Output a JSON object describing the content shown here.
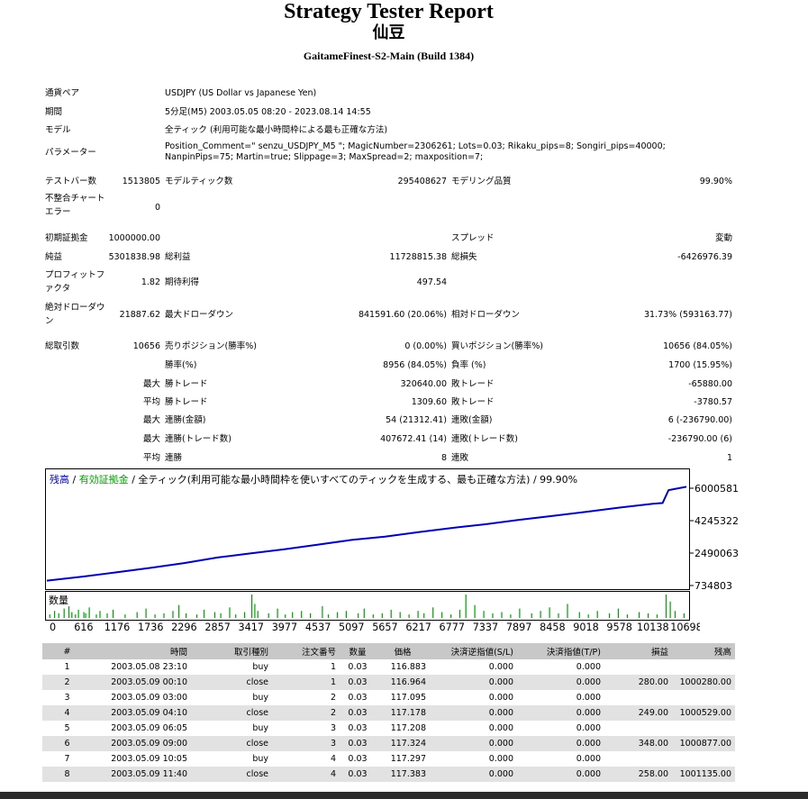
{
  "header": {
    "title": "Strategy Tester Report",
    "ea_name": "仙豆",
    "server": "GaitameFinest-S2-Main (Build 1384)"
  },
  "settings": [
    {
      "label": "通貨ペア",
      "value": "USDJPY (US Dollar vs Japanese Yen)"
    },
    {
      "label": "期間",
      "value": "5分足(M5) 2003.05.05 08:20 - 2023.08.14 14:55"
    },
    {
      "label": "モデル",
      "value": "全ティック (利用可能な最小時間枠による最も正確な方法)"
    },
    {
      "label": "パラメーター",
      "value": "Position_Comment=\" senzu_USDJPY_M5 \"; MagicNumber=2306261; Lots=0.03; Rikaku_pips=8; Songiri_pips=40000; NanpinPips=75; Martin=true; Slippage=3; MaxSpread=2; maxposition=7;"
    }
  ],
  "stats": {
    "bars_label": "テストバー数",
    "bars_value": "1513805",
    "ticks_label": "モデルティック数",
    "ticks_value": "295408627",
    "quality_label": "モデリング品質",
    "quality_value": "99.90%",
    "mismatch_label": "不整合チャートエラー",
    "mismatch_value": "0",
    "deposit_label": "初期証拠金",
    "deposit_value": "1000000.00",
    "spread_label": "スプレッド",
    "spread_value": "変動",
    "net_label": "純益",
    "net_value": "5301838.98",
    "gross_profit_label": "総利益",
    "gross_profit_value": "11728815.38",
    "gross_loss_label": "総損失",
    "gross_loss_value": "-6426976.39",
    "pf_label": "プロフィットファクタ",
    "pf_value": "1.82",
    "expected_label": "期待利得",
    "expected_value": "497.54",
    "abs_dd_label": "絶対ドローダウン",
    "abs_dd_value": "21887.62",
    "max_dd_label": "最大ドローダウン",
    "max_dd_value": "841591.60 (20.06%)",
    "rel_dd_label": "相対ドローダウン",
    "rel_dd_value": "31.73% (593163.77)",
    "total_label": "総取引数",
    "total_value": "10656",
    "short_label": "売りポジション(勝率%)",
    "short_value": "0 (0.00%)",
    "long_label": "買いポジション(勝率%)",
    "long_value": "10656 (84.05%)",
    "win_label": "勝率(%)",
    "win_value": "8956 (84.05%)",
    "loss_label": "負率 (%)",
    "loss_value": "1700 (15.95%)",
    "max_word": "最大",
    "avg_word": "平均",
    "largest_win_label": "勝トレード",
    "largest_win_value": "320640.00",
    "largest_loss_label": "敗トレード",
    "largest_loss_value": "-65880.00",
    "avg_win_label": "勝トレード",
    "avg_win_value": "1309.60",
    "avg_loss_label": "敗トレード",
    "avg_loss_value": "-3780.57",
    "cons_wins_amt_label": "連勝(金額)",
    "cons_wins_amt_value": "54 (21312.41)",
    "cons_loss_amt_label": "連敗(金額)",
    "cons_loss_amt_value": "6 (-236790.00)",
    "cons_wins_cnt_label": "連勝(トレード数)",
    "cons_wins_cnt_value": "407672.41 (14)",
    "cons_loss_cnt_label": "連敗(トレード数)",
    "cons_loss_cnt_value": "-236790.00 (6)",
    "avg_cons_wins_label": "連勝",
    "avg_cons_wins_value": "8",
    "avg_cons_loss_label": "連敗",
    "avg_cons_loss_value": "1"
  },
  "chart_legend": {
    "balance": "残高",
    "sep1": " / ",
    "equity": "有効証拠金",
    "sep2": " / ",
    "rest": "全ティック(利用可能な最小時間枠を使いすべてのティックを生成する、最も正確な方法) / 99.90%"
  },
  "volume_label": "数量",
  "chart_data": {
    "type": "line",
    "title": "",
    "y_ticks": [
      "6000581",
      "4245322",
      "2490063",
      "734803"
    ],
    "x_ticks": [
      "0",
      "616",
      "1176",
      "1736",
      "2296",
      "2857",
      "3417",
      "3977",
      "4537",
      "5097",
      "5657",
      "6217",
      "6777",
      "7337",
      "7897",
      "8458",
      "9018",
      "9578",
      "10138",
      "10698"
    ],
    "ylim": [
      734803,
      6000581
    ],
    "xlim": [
      0,
      10698
    ],
    "series": [
      {
        "name": "残高",
        "color": "#0000b4",
        "x": [
          0,
          616,
          1176,
          1736,
          2296,
          2857,
          3417,
          3977,
          4537,
          5097,
          5657,
          6217,
          6777,
          7337,
          7897,
          8458,
          9018,
          9578,
          10138,
          10300,
          10400,
          10698
        ],
        "y": [
          1000000,
          1220000,
          1450000,
          1690000,
          1950000,
          2250000,
          2480000,
          2700000,
          2950000,
          3200000,
          3380000,
          3620000,
          3850000,
          4050000,
          4290000,
          4500000,
          4720000,
          4950000,
          5160000,
          5200000,
          5900000,
          6080000
        ]
      },
      {
        "name": "有効証拠金",
        "color": "#00a000"
      }
    ],
    "volume_x": [
      40,
      120,
      190,
      280,
      360,
      410,
      470,
      520,
      610,
      640,
      700,
      820,
      880,
      1000,
      1100,
      1300,
      1500,
      1650,
      1800,
      1950,
      2100,
      2200,
      2320,
      2500,
      2620,
      2800,
      2900,
      3050,
      3150,
      3300,
      3420,
      3470,
      3520,
      3700,
      3850,
      3980,
      4100,
      4250,
      4400,
      4600,
      4700,
      4850,
      5000,
      5200,
      5300,
      5450,
      5600,
      5750,
      5900,
      6050,
      6200,
      6300,
      6450,
      6600,
      6750,
      6900,
      7000,
      7150,
      7300,
      7450,
      7600,
      7750,
      7900,
      8100,
      8250,
      8400,
      8550,
      8700,
      8900,
      9050,
      9200,
      9400,
      9550,
      9700,
      9900,
      10050,
      10200,
      10350,
      10420,
      10500,
      10650
    ],
    "volume_v": [
      3,
      6,
      4,
      8,
      10,
      5,
      3,
      7,
      5,
      4,
      9,
      3,
      6,
      4,
      7,
      3,
      5,
      8,
      3,
      4,
      6,
      11,
      4,
      3,
      7,
      5,
      4,
      9,
      3,
      5,
      20,
      12,
      6,
      4,
      8,
      3,
      5,
      6,
      4,
      10,
      3,
      5,
      6,
      4,
      8,
      3,
      4,
      7,
      5,
      3,
      6,
      4,
      9,
      5,
      3,
      7,
      20,
      11,
      6,
      4,
      5,
      3,
      8,
      4,
      6,
      9,
      4,
      12,
      5,
      3,
      6,
      4,
      8,
      3,
      5,
      4,
      3,
      20,
      14,
      6,
      4
    ]
  },
  "trades": {
    "headers": [
      "#",
      "時間",
      "取引種別",
      "注文番号",
      "数量",
      "価格",
      "決済逆指値(S/L)",
      "決済指値(T/P)",
      "損益",
      "残高"
    ],
    "rows": [
      [
        "1",
        "2003.05.08 23:10",
        "buy",
        "1",
        "0.03",
        "116.883",
        "0.000",
        "0.000",
        "",
        ""
      ],
      [
        "2",
        "2003.05.09 00:10",
        "close",
        "1",
        "0.03",
        "116.964",
        "0.000",
        "0.000",
        "280.00",
        "1000280.00"
      ],
      [
        "3",
        "2003.05.09 03:00",
        "buy",
        "2",
        "0.03",
        "117.095",
        "0.000",
        "0.000",
        "",
        ""
      ],
      [
        "4",
        "2003.05.09 04:10",
        "close",
        "2",
        "0.03",
        "117.178",
        "0.000",
        "0.000",
        "249.00",
        "1000529.00"
      ],
      [
        "5",
        "2003.05.09 06:05",
        "buy",
        "3",
        "0.03",
        "117.208",
        "0.000",
        "0.000",
        "",
        ""
      ],
      [
        "6",
        "2003.05.09 09:00",
        "close",
        "3",
        "0.03",
        "117.324",
        "0.000",
        "0.000",
        "348.00",
        "1000877.00"
      ],
      [
        "7",
        "2003.05.09 10:05",
        "buy",
        "4",
        "0.03",
        "117.297",
        "0.000",
        "0.000",
        "",
        ""
      ],
      [
        "8",
        "2003.05.09 11:40",
        "close",
        "4",
        "0.03",
        "117.383",
        "0.000",
        "0.000",
        "258.00",
        "1001135.00"
      ]
    ]
  }
}
